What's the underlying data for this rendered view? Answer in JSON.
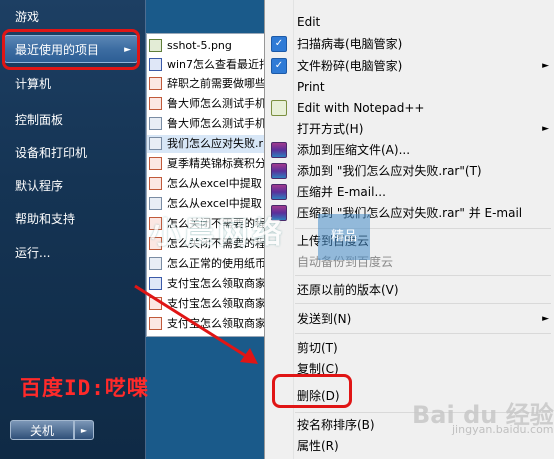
{
  "start_menu": {
    "items": [
      {
        "label": "游戏"
      },
      {
        "label": "最近使用的项目"
      },
      {
        "label": "计算机"
      },
      {
        "label": "控制面板"
      },
      {
        "label": "设备和打印机"
      },
      {
        "label": "默认程序"
      },
      {
        "label": "帮助和支持"
      },
      {
        "label": "运行..."
      }
    ],
    "shutdown_label": "关机",
    "arrow": "►",
    "shutdown_arrow": "►"
  },
  "recent_items": [
    {
      "label": "sshot-5.png",
      "icon": "image-file-icon"
    },
    {
      "label": "win7怎么查看最近打",
      "icon": "word-file-icon"
    },
    {
      "label": "辞职之前需要做哪些",
      "icon": "doc-file-icon"
    },
    {
      "label": "鲁大师怎么测试手机",
      "icon": "doc-file-icon"
    },
    {
      "label": "鲁大师怎么测试手机",
      "icon": "doc-file-icon"
    },
    {
      "label": "我们怎么应对失败.r",
      "icon": "doc-file-icon"
    },
    {
      "label": "夏季精英锦标赛积分",
      "icon": "pdf-file-icon"
    },
    {
      "label": "怎么从excel中提取",
      "icon": "doc-file-icon"
    },
    {
      "label": "怎么从excel中提取",
      "icon": "doc-file-icon"
    },
    {
      "label": "怎么关闭不需要的程",
      "icon": "doc-file-icon"
    },
    {
      "label": "怎么关闭不需要的程",
      "icon": "doc-file-icon"
    },
    {
      "label": "怎么正常的使用纸币",
      "icon": "doc-file-icon"
    },
    {
      "label": "支付宝怎么领取商家",
      "icon": "word-file-icon"
    },
    {
      "label": "支付宝怎么领取商家",
      "icon": "doc-file-icon"
    },
    {
      "label": "支付宝怎么领取商家",
      "icon": "doc-file-icon"
    }
  ],
  "context_menu": {
    "items": [
      {
        "label": "Edit"
      },
      {
        "label": "扫描病毒(电脑管家)",
        "icon": "shield-icon"
      },
      {
        "label": "文件粉碎(电脑管家)",
        "icon": "shield-icon",
        "submenu": true
      },
      {
        "label": "Print"
      },
      {
        "label": "Edit with Notepad++",
        "icon": "notepad-icon"
      },
      {
        "label": "打开方式(H)",
        "submenu": true
      },
      {
        "label": "添加到压缩文件(A)...",
        "icon": "winrar-icon"
      },
      {
        "label": "添加到 \"我们怎么应对失败.rar\"(T)",
        "icon": "winrar-icon"
      },
      {
        "label": "压缩并 E-mail...",
        "icon": "winrar-icon"
      },
      {
        "label": "压缩到 \"我们怎么应对失败.rar\" 并 E-mail",
        "icon": "winrar-icon"
      },
      {
        "label": "上传到百度云"
      },
      {
        "label": "自动备份到百度云",
        "disabled": true
      },
      {
        "label": "还原以前的版本(V)"
      },
      {
        "label": "发送到(N)",
        "submenu": true
      },
      {
        "label": "剪切(T)"
      },
      {
        "label": "复制(C)"
      },
      {
        "label": "删除(D)"
      },
      {
        "label": "按名称排序(B)"
      },
      {
        "label": "属性(R)"
      }
    ],
    "submenu_arrow": "►"
  },
  "annotations": {
    "caption": "百度ID:呓喋",
    "watermark": "小晨网络",
    "watermark_box": "精品",
    "baidu_logo": "Bai du 经验",
    "baidu_sub": "jingyan.baidu.com"
  },
  "colors": {
    "annotation_red": "#e01515",
    "start_menu_bg": "#153454",
    "highlight": "#3d6da2",
    "menu_bg": "#f0f0f0"
  }
}
